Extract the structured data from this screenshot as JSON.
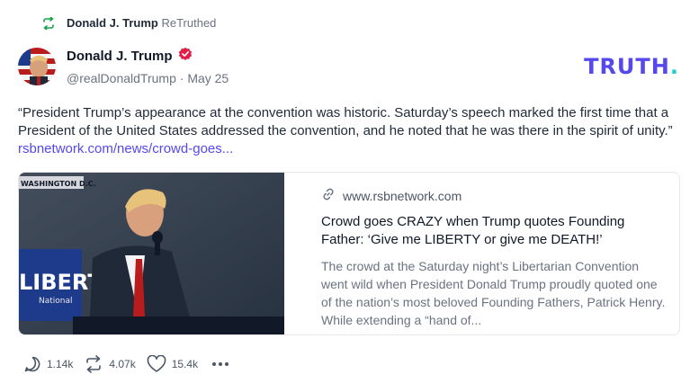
{
  "retruth": {
    "user": "Donald J. Trump",
    "label": "ReTruthed",
    "icon": "retruth-icon"
  },
  "post": {
    "author": {
      "display_name": "Donald J. Trump",
      "handle": "@realDonaldTrump",
      "date": "May 25",
      "verified": true,
      "verified_icon": "verified-badge-icon"
    },
    "text": "“President Trump’s appearance at the convention was historic. Saturday’s speech marked the first time that a President of the United States addressed the convention, and he noted that he was there in the spirit of unity.”",
    "link_text": "rsbnetwork.com/news/crowd-goes..."
  },
  "brand": {
    "name": "TRUTH",
    "dot": ".",
    "color": "#5448ee",
    "dot_color": "#17d1c6"
  },
  "card": {
    "image_caption": "WASHINGTON D.C.",
    "image_sign_text": "LIBERTA",
    "image_sign_subtext": "National",
    "domain": "www.rsbnetwork.com",
    "title": "Crowd goes CRAZY when Trump quotes Founding Father: ‘Give me LIBERTY or give me DEATH!’",
    "description": "The crowd at the Saturday night’s Libertarian Convention went wild when President Donald Trump proudly quoted one of the nation’s most beloved Founding Fathers, Patrick Henry. While extending a “hand of..."
  },
  "actions": {
    "replies": "1.14k",
    "retruths": "4.07k",
    "likes": "15.4k",
    "reply_icon": "reply-icon",
    "retruth_icon": "retruth-icon",
    "like_icon": "heart-icon",
    "more_icon": "more-icon"
  },
  "colors": {
    "accent": "#5448ee",
    "retruth_green": "#16a34a",
    "verified_badge": "#e11d48"
  }
}
